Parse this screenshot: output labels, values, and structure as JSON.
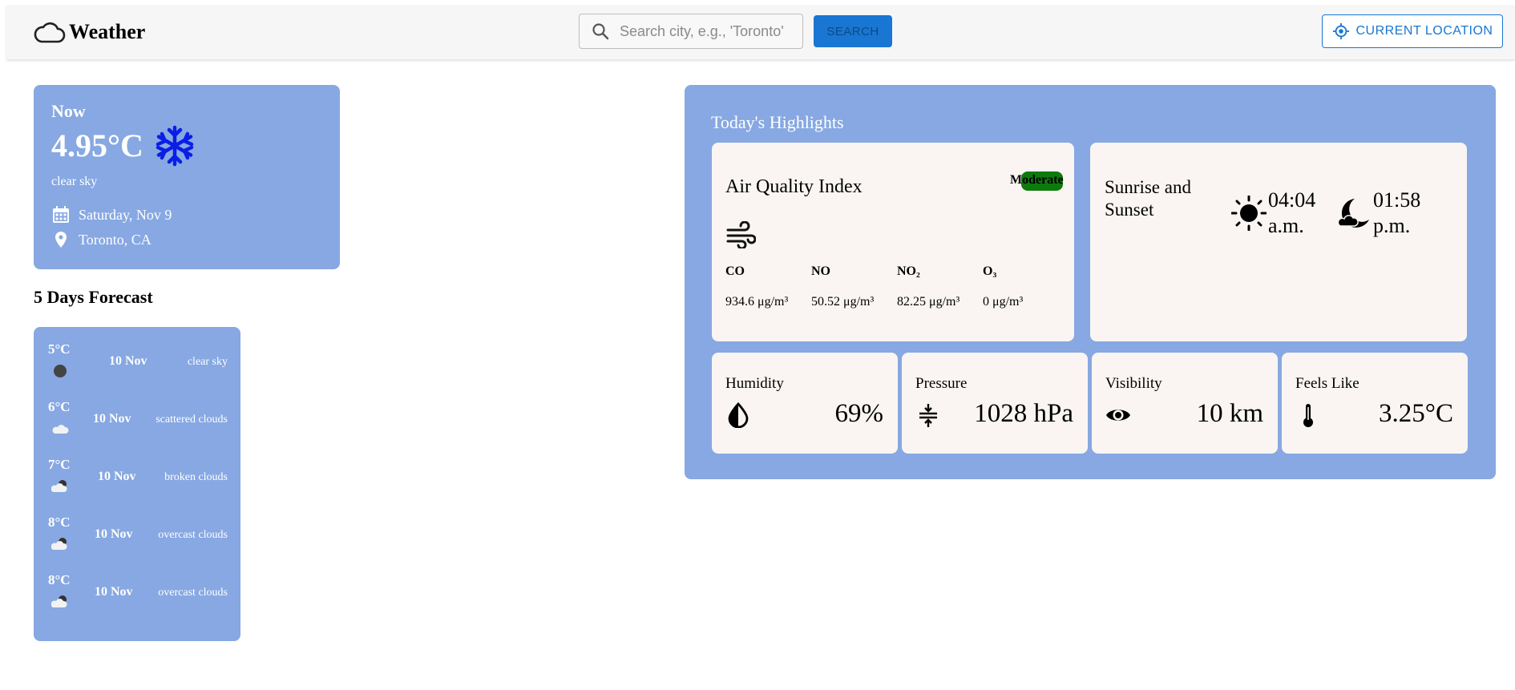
{
  "header": {
    "title": "Weather",
    "search_placeholder": "Search city, e.g., 'Toronto'",
    "search_button": "SEARCH",
    "location_button": "CURRENT LOCATION"
  },
  "now": {
    "label": "Now",
    "temperature": "4.95°C",
    "description": "clear sky",
    "date": "Saturday, Nov 9",
    "location": "Toronto, CA",
    "icon": "snowflake-icon"
  },
  "forecast": {
    "title": "5 Days Forecast",
    "days": [
      {
        "temp": "5°C",
        "date": "10 Nov",
        "desc": "clear sky",
        "icon": "moon-dot-icon"
      },
      {
        "temp": "6°C",
        "date": "10 Nov",
        "desc": "scattered clouds",
        "icon": "cloud-icon"
      },
      {
        "temp": "7°C",
        "date": "10 Nov",
        "desc": "broken clouds",
        "icon": "cloud-moon-icon"
      },
      {
        "temp": "8°C",
        "date": "10 Nov",
        "desc": "overcast clouds",
        "icon": "cloud-moon-icon"
      },
      {
        "temp": "8°C",
        "date": "10 Nov",
        "desc": "overcast clouds",
        "icon": "cloud-moon-icon"
      }
    ]
  },
  "highlights": {
    "title": "Today's Highlights",
    "aqi": {
      "title": "Air Quality Index",
      "badge": "Moderate",
      "pollutants": [
        {
          "name": "CO",
          "value": "934.6 μg/m³"
        },
        {
          "name": "NO",
          "value": "50.52 μg/m³"
        },
        {
          "name": "NO₂",
          "value": "82.25 μg/m³"
        },
        {
          "name": "O₃",
          "value": "0 μg/m³"
        }
      ]
    },
    "sun": {
      "title": "Sunrise and Sunset",
      "sunrise": "04:04 a.m.",
      "sunset": "01:58 p.m."
    },
    "humidity": {
      "label": "Humidity",
      "value": "69%"
    },
    "pressure": {
      "label": "Pressure",
      "value": "1028 hPa"
    },
    "visibility": {
      "label": "Visibility",
      "value": "10 km"
    },
    "feels_like": {
      "label": "Feels Like",
      "value": "3.25°C"
    }
  }
}
